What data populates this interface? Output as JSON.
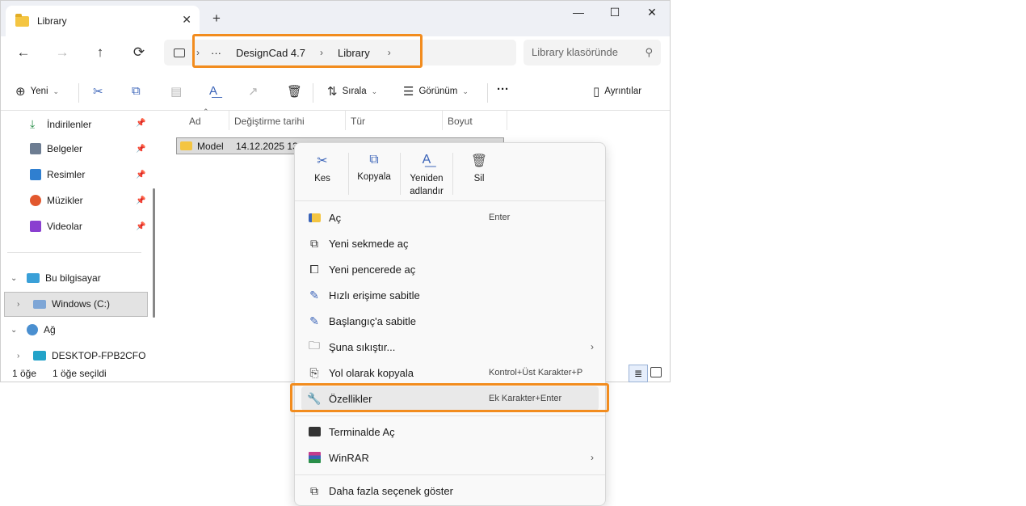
{
  "tab": {
    "title": "Library",
    "close": "✕",
    "new": "+"
  },
  "window_controls": {
    "minimize": "—",
    "maximize": "☐",
    "close": "✕"
  },
  "nav": {
    "back": "←",
    "forward": "→",
    "up": "↑",
    "refresh": "⟳"
  },
  "address": {
    "more": "···",
    "crumbs": [
      "DesignCad 4.7",
      "Library"
    ],
    "sep": "›"
  },
  "search": {
    "placeholder": "Library klasöründe",
    "icon": "⚲"
  },
  "toolbar": {
    "new_label": "Yeni",
    "sort_label": "Sırala",
    "view_label": "Görünüm",
    "more": "···",
    "details_label": "Ayrıntılar"
  },
  "sidebar": {
    "items": [
      {
        "label": "İndirilenler",
        "icon": "download-icon",
        "color": "#2a8f4a"
      },
      {
        "label": "Belgeler",
        "icon": "documents-icon",
        "color": "#6d7d92"
      },
      {
        "label": "Resimler",
        "icon": "pictures-icon",
        "color": "#2f7fd0"
      },
      {
        "label": "Müzikler",
        "icon": "music-icon",
        "color": "#e2582e"
      },
      {
        "label": "Videolar",
        "icon": "videos-icon",
        "color": "#8a3fd0"
      }
    ],
    "this_pc": "Bu bilgisayar",
    "drive": "Windows  (C:)",
    "network": "Ağ",
    "computer": "DESKTOP-FPB2CFO"
  },
  "columns": [
    "Ad",
    "Değiştirme tarihi",
    "Tür",
    "Boyut"
  ],
  "rows": [
    {
      "name": "Model",
      "date": "14.12.2025 13:1"
    }
  ],
  "status": {
    "count": "1 öğe",
    "selected": "1 öğe seçildi"
  },
  "context_menu": {
    "quick": [
      "Kes",
      "Kopyala",
      "Yeniden\nadlandır",
      "Sil"
    ],
    "items": [
      {
        "label": "Aç",
        "shortcut": "Enter"
      },
      {
        "label": "Yeni sekmede aç",
        "shortcut": ""
      },
      {
        "label": "Yeni pencerede aç",
        "shortcut": ""
      },
      {
        "label": "Hızlı erişime sabitle",
        "shortcut": ""
      },
      {
        "label": "Başlangıç'a sabitle",
        "shortcut": ""
      },
      {
        "label": "Şuna sıkıştır...",
        "shortcut": ""
      },
      {
        "label": "Yol olarak kopyala",
        "shortcut": "Kontrol+Üst Karakter+P"
      },
      {
        "label": "Özellikler",
        "shortcut": "Ek Karakter+Enter"
      },
      {
        "label": "Terminalde Aç",
        "shortcut": ""
      },
      {
        "label": "WinRAR",
        "shortcut": ""
      },
      {
        "label": "Daha fazla seçenek göster",
        "shortcut": ""
      }
    ],
    "submenu_arrow": "›"
  },
  "accent": {
    "callout": "#f28c1e",
    "icon_blue": "#3a63b8",
    "folder": "#f4c542"
  }
}
